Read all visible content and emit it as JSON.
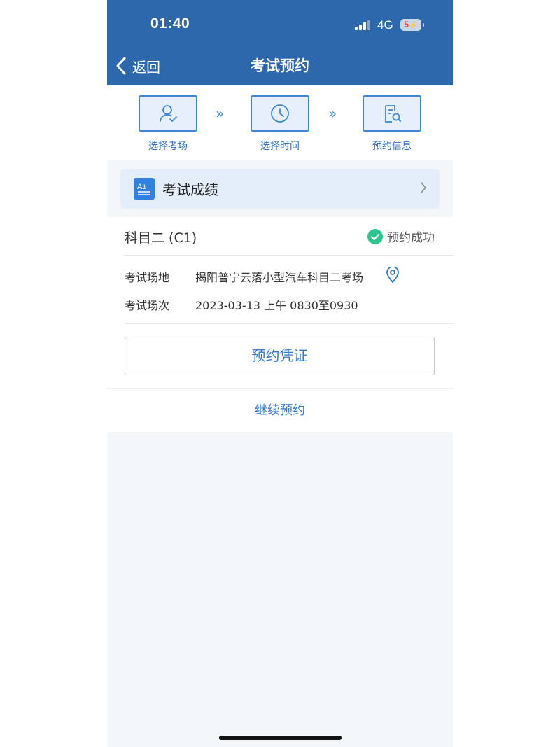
{
  "status_bar": {
    "time": "01:40",
    "network": "4G",
    "battery": "5",
    "battery_charging_glyph": "⚡"
  },
  "nav": {
    "back_label": "返回",
    "title": "考试预约"
  },
  "steps": [
    {
      "label": "选择考场",
      "icon": "user-check-icon"
    },
    {
      "label": "选择时间",
      "icon": "clock-icon"
    },
    {
      "label": "预约信息",
      "icon": "document-search-icon"
    }
  ],
  "step_arrow": "»",
  "score_card": {
    "label": "考试成绩",
    "icon_text": "A±"
  },
  "booking": {
    "subject": "科目二 (C1)",
    "status": "预约成功",
    "status_color": "#2dc58c",
    "venue_label": "考试场地",
    "venue_value": "揭阳普宁云落小型汽车科目二考场",
    "session_label": "考试场次",
    "session_value": "2023-03-13 上午 0830至0930"
  },
  "voucher_button": "预约凭证",
  "continue_link": "继续预约",
  "colors": {
    "header": "#2d68ad",
    "accent": "#2f7bd3",
    "page_bg": "#f4f7f9"
  }
}
